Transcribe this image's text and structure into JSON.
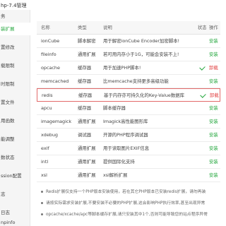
{
  "title": "hp-7.4管理",
  "sidebar": {
    "items": [
      {
        "label": "务"
      },
      {
        "label": "装扩展"
      },
      {
        "label": "置修改"
      },
      {
        "label": "载限制"
      },
      {
        "label": "时限制"
      },
      {
        "label": "置文件"
      },
      {
        "label": "用函数"
      },
      {
        "label": "能调整"
      },
      {
        "label": "数状态"
      },
      {
        "label": "ssion配置"
      },
      {
        "label": "志"
      },
      {
        "label": "日志"
      },
      {
        "label": "npinfo"
      }
    ]
  },
  "table": {
    "headers": {
      "name": "名称",
      "type": "类型",
      "desc": "说明",
      "status": "状态",
      "op": "操作"
    },
    "rows": [
      {
        "name": "ionCube",
        "type": "脚本解密",
        "desc": "用于解密ionCube Encoder加密脚本!",
        "installed": false,
        "op": "安装"
      },
      {
        "name": "fileinfo",
        "type": "通用扩展",
        "desc": "若可用内存小于1G，可能会安装不上!",
        "installed": false,
        "op": "安装"
      },
      {
        "name": "opcache",
        "type": "缓存器",
        "desc": "用于加速PHP脚本!",
        "installed": true,
        "op": "卸载"
      },
      {
        "name": "memcached",
        "type": "缓存器",
        "desc": "比memcache支持更多高级功能",
        "installed": false,
        "op": "安装"
      },
      {
        "name": "redis",
        "type": "缓存器",
        "desc": "基于内存亦可持久化的Key-Value数据库",
        "installed": true,
        "op": "卸载"
      },
      {
        "name": "apcu",
        "type": "缓存器",
        "desc": "脚本缓存器",
        "installed": false,
        "op": "安装"
      },
      {
        "name": "imagemagick",
        "type": "通用扩展",
        "desc": "Imagick高性能图形库",
        "installed": false,
        "op": "安装"
      },
      {
        "name": "xdebug",
        "type": "调试器",
        "desc": "开源的PHP程序调试器",
        "installed": false,
        "op": "安装"
      },
      {
        "name": "exif",
        "type": "通用扩展",
        "desc": "用于读取图片EXIF信息",
        "installed": false,
        "op": "安装"
      },
      {
        "name": "intl",
        "type": "通用扩展",
        "desc": "提供国际化支持",
        "installed": false,
        "op": "安装"
      },
      {
        "name": "xsl",
        "type": "通用扩展",
        "desc": "xsl解析扩展",
        "installed": false,
        "op": "安装"
      }
    ]
  },
  "notes": [
    "Redis扩展仅支持一个PHP版本安装使用，若在其它PHP版本已安装redis扩展，请勿再装",
    "请按实际需求安装扩展,不要安装不必要的PHP扩展,这会影响PHP执行效率,甚至出现异常",
    "opcache/xcache/apc等脚本缓存扩展,请只安装其中1个,否则可能导致您的站点程序异常"
  ],
  "colors": {
    "accent": "#20a53a",
    "danger": "#e03c3c",
    "highlight_border": "#e26a6a"
  }
}
